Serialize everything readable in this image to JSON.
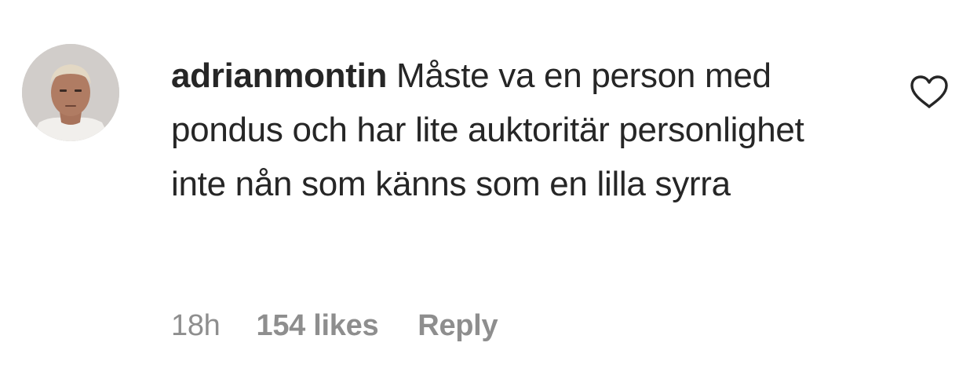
{
  "comment": {
    "username": "adrianmontin",
    "text": "Måste va en person med pondus och har lite auktoritär personlighet inte nån som känns som en lilla syrra",
    "time": "18h",
    "likes": "154 likes",
    "reply_label": "Reply",
    "like_icon": "heart-outline-icon",
    "avatar_icon": "profile-photo"
  },
  "colors": {
    "primary_text": "#262626",
    "secondary_text": "#8e8e8e",
    "background": "#ffffff"
  }
}
